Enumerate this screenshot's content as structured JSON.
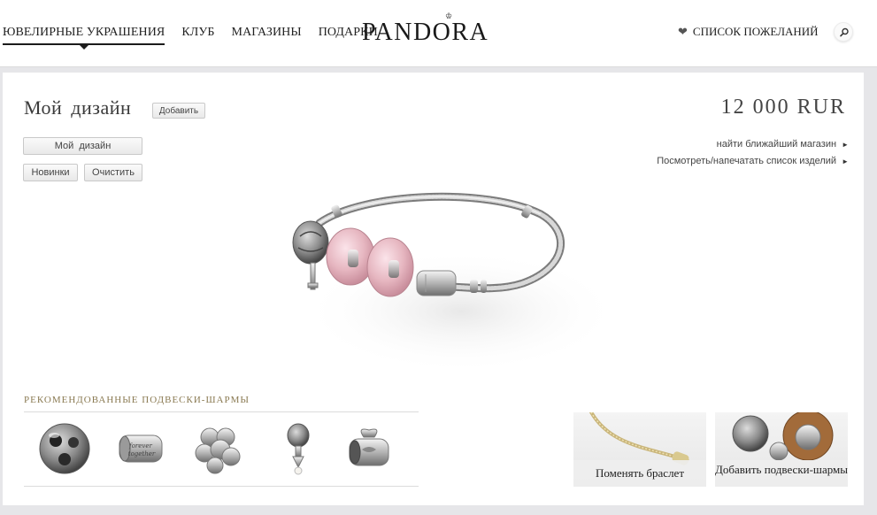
{
  "header": {
    "nav": [
      {
        "label": "ЮВЕЛИРНЫЕ УКРАШЕНИЯ",
        "active": true
      },
      {
        "label": "КЛУБ"
      },
      {
        "label": "МАГАЗИНЫ"
      },
      {
        "label": "ПОДАРКИ"
      }
    ],
    "logo": "PANDORA",
    "wishlist_label": "СПИСОК ПОЖЕЛАНИЙ",
    "icons": {
      "wishlist": "heart-icon",
      "search": "search-icon"
    }
  },
  "design": {
    "title": "Мой  дизайн",
    "add_label": "Добавить",
    "mydesign_label": "Мой  дизайн",
    "new_label": "Новинки",
    "clear_label": "Очистить",
    "price": "12 000 RUR",
    "links": [
      {
        "label": "найти ближайший магазин"
      },
      {
        "label": "Посмотреть/напечатать список изделий"
      }
    ]
  },
  "recommended": {
    "title": "РЕКОМЕНДОВАННЫЕ ПОДВЕСКИ-ШАРМЫ",
    "charms": [
      "silver-ball-charm",
      "together-text-charm",
      "bead-cluster-charm",
      "dangle-pearl-charm",
      "bow-charm"
    ]
  },
  "actions": {
    "change_bracelet": "Поменять браслет",
    "add_charms": "Добавить подвески-шармы"
  },
  "colors": {
    "accent_gold": "#8a7a52",
    "text_dark": "#222222",
    "pink_bead": "#e6b6c0"
  }
}
